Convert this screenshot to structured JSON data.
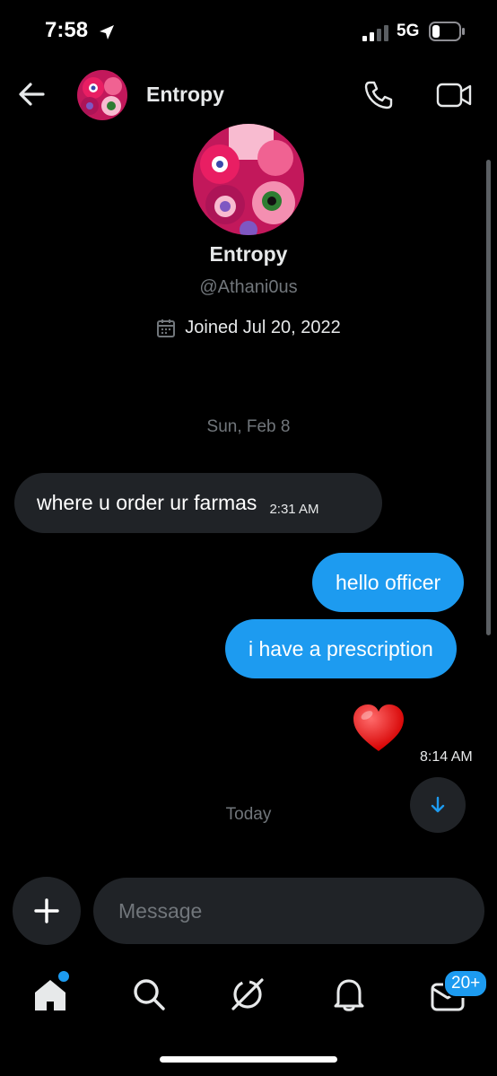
{
  "status_bar": {
    "time": "7:58",
    "network": "5G"
  },
  "header": {
    "name": "Entropy"
  },
  "profile": {
    "name": "Entropy",
    "handle": "@Athani0us",
    "joined": "Joined Jul 20, 2022"
  },
  "conversation": {
    "date_1": "Sun, Feb 8",
    "incoming": {
      "text": "where u order ur farmas",
      "time": "2:31 AM"
    },
    "outgoing": [
      {
        "text": "hello officer"
      },
      {
        "text": "i have a prescription"
      }
    ],
    "reaction_emoji": "❤️",
    "outgoing_time": "8:14 AM",
    "date_2": "Today"
  },
  "composer": {
    "placeholder": "Message"
  },
  "nav": {
    "messages_badge": "20+"
  },
  "colors": {
    "accent": "#1d9bf0",
    "bubble_in": "#202327",
    "background": "#000000"
  }
}
